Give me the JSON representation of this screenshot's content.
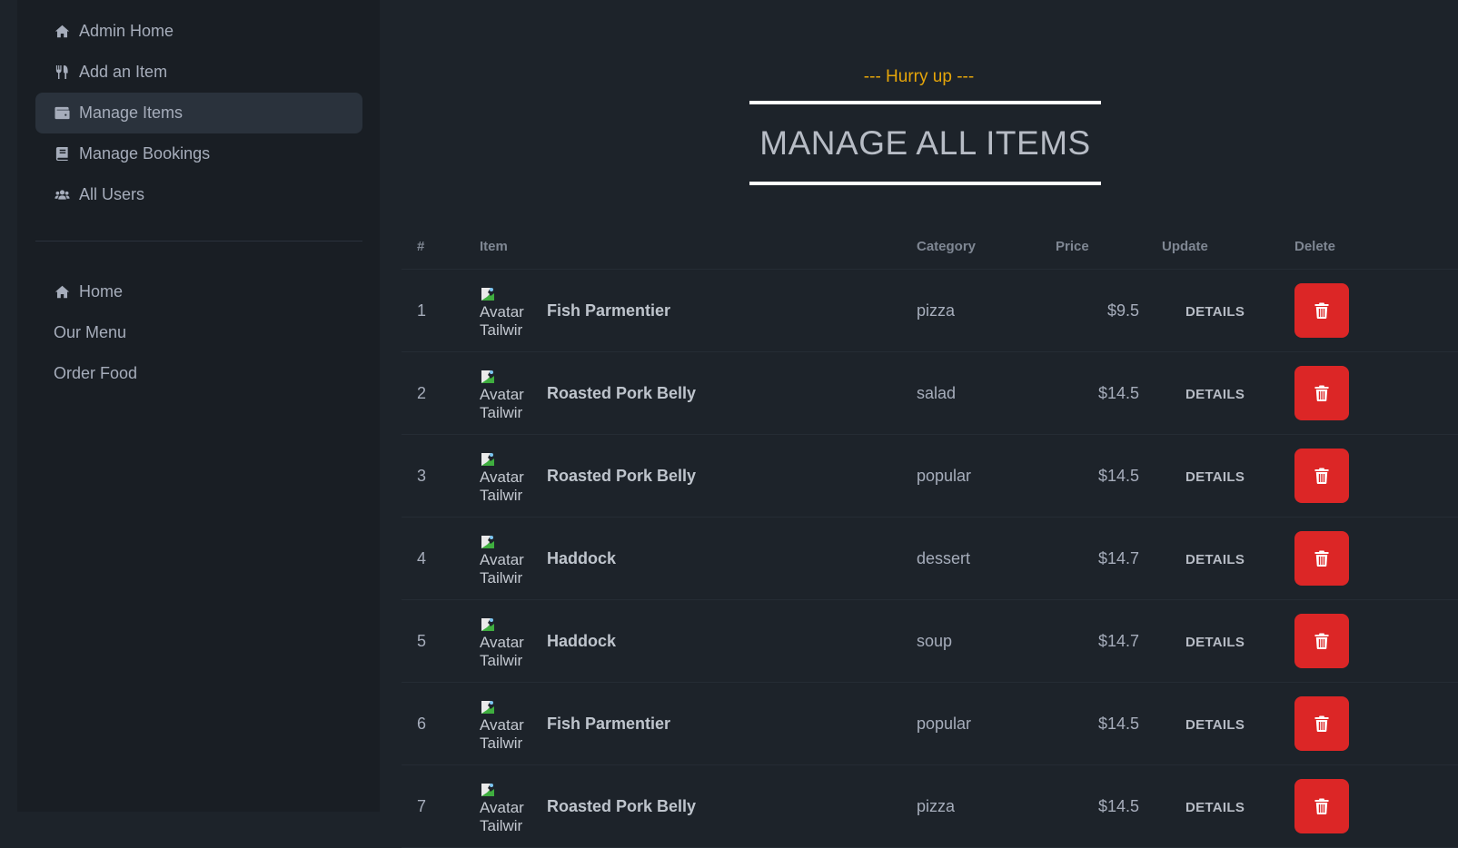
{
  "sidebar": {
    "admin_items": [
      {
        "label": "Admin Home",
        "icon": "home-icon"
      },
      {
        "label": "Add an Item",
        "icon": "utensils-icon"
      },
      {
        "label": "Manage Items",
        "icon": "wallet-icon",
        "active": true
      },
      {
        "label": "Manage Bookings",
        "icon": "book-icon"
      },
      {
        "label": "All Users",
        "icon": "users-icon"
      }
    ],
    "public_items": [
      {
        "label": "Home",
        "icon": "home-icon"
      },
      {
        "label": "Our Menu",
        "icon": ""
      },
      {
        "label": "Order Food",
        "icon": ""
      }
    ]
  },
  "header": {
    "subtitle": "--- Hurry up ---",
    "title": "MANAGE ALL ITEMS"
  },
  "table": {
    "columns": [
      "#",
      "Item",
      "Category",
      "Price",
      "Update",
      "Delete"
    ],
    "image_alt": "Avatar Tailwind",
    "avatar_text_1": "Avatar",
    "avatar_text_2": "Tailwir",
    "update_label": "DETAILS",
    "rows": [
      {
        "num": "1",
        "name": "Fish Parmentier",
        "category": "pizza",
        "price": "$9.5"
      },
      {
        "num": "2",
        "name": "Roasted Pork Belly",
        "category": "salad",
        "price": "$14.5"
      },
      {
        "num": "3",
        "name": "Roasted Pork Belly",
        "category": "popular",
        "price": "$14.5"
      },
      {
        "num": "4",
        "name": "Haddock",
        "category": "dessert",
        "price": "$14.7"
      },
      {
        "num": "5",
        "name": "Haddock",
        "category": "soup",
        "price": "$14.7"
      },
      {
        "num": "6",
        "name": "Fish Parmentier",
        "category": "popular",
        "price": "$14.5"
      },
      {
        "num": "7",
        "name": "Roasted Pork Belly",
        "category": "pizza",
        "price": "$14.5"
      }
    ]
  },
  "colors": {
    "background": "#1d232a",
    "sidebar": "#191e24",
    "accent": "#e5a50a",
    "delete": "#dc2626"
  }
}
